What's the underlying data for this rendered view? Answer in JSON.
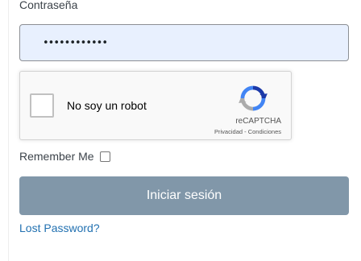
{
  "form": {
    "password_label": "Contraseña",
    "password_value": "••••••••••••",
    "remember_label": "Remember Me",
    "remember_checked": false,
    "submit_label": "Iniciar sesión",
    "lost_password_label": "Lost Password?"
  },
  "recaptcha": {
    "checkbox_label": "No soy un robot",
    "brand": "reCAPTCHA",
    "privacy_label": "Privacidad",
    "separator": " - ",
    "terms_label": "Condiciones",
    "icon": "recaptcha-logo-icon"
  },
  "colors": {
    "input_bg": "#e8f0fe",
    "button_bg": "#8197a9",
    "link": "#2271b1"
  }
}
